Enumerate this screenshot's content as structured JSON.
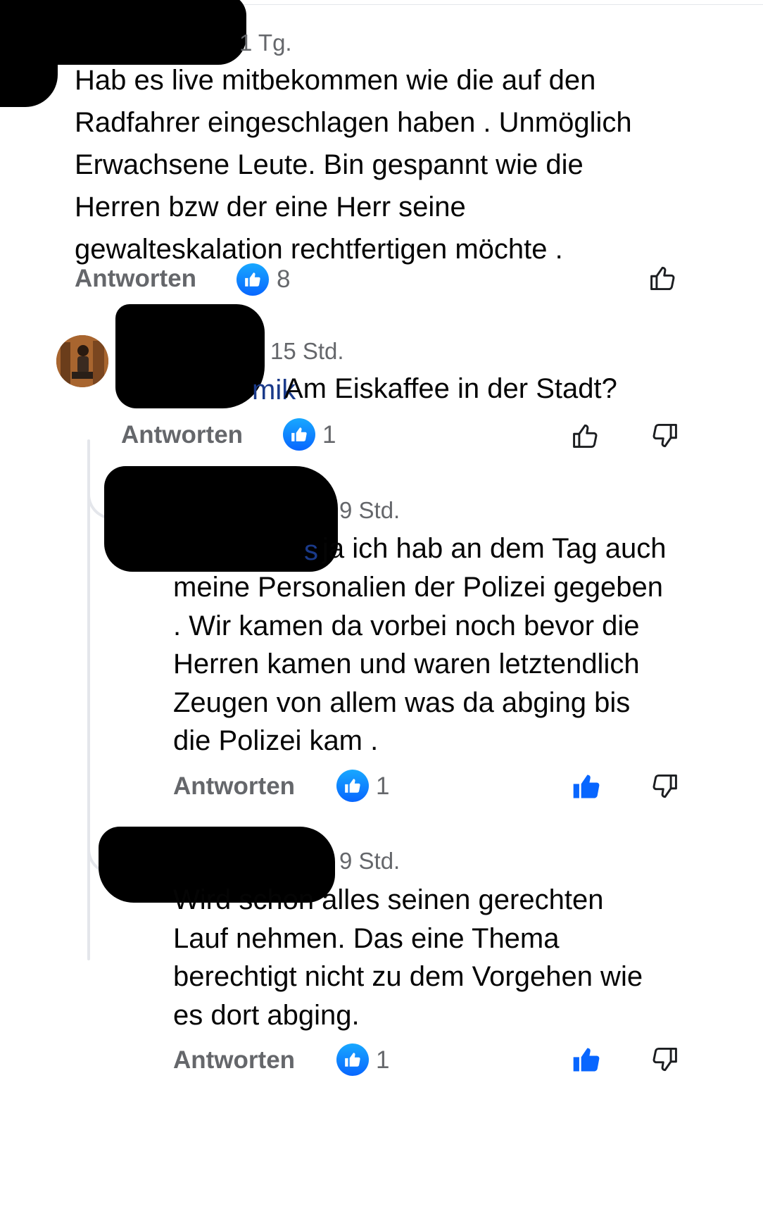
{
  "reply_label": "Antworten",
  "colors": {
    "like_blue": "#0866ff",
    "meta_gray": "#65676b",
    "text": "#050505",
    "thread_line": "#e4e6eb"
  },
  "comments": [
    {
      "time": "1 Tg.",
      "lines": [
        "Hab es live mitbekommen wie die auf den",
        "Radfahrer eingeschlagen haben . Unmöglich",
        "Erwachsene Leute.  Bin gespannt wie die",
        "Herren bzw der eine Herr seine",
        "gewalteskalation rechtfertigen möchte ."
      ],
      "reactions": "8",
      "liked": false
    },
    {
      "time": "15 Std.",
      "mention_fragment": "mik",
      "lines": [
        "Am Eiskaffee in der Stadt?"
      ],
      "reactions": "1",
      "liked": false
    },
    {
      "time": "9 Std.",
      "mention_fragment": "s",
      "lines": [
        "ja ich hab an dem Tag auch",
        "meine Personalien der Polizei gegeben",
        ". Wir kamen da vorbei noch bevor die",
        "Herren kamen und waren letztendlich",
        "Zeugen von allem  was da abging bis",
        "die Polizei kam ."
      ],
      "reactions": "1",
      "liked": true
    },
    {
      "time": "9 Std.",
      "lines": [
        "Wird schon alles seinen gerechten",
        "Lauf nehmen.  Das eine Thema",
        "berechtigt nicht zu dem  Vorgehen wie",
        "es dort abging."
      ],
      "reactions": "1",
      "liked": true
    }
  ],
  "icons": {
    "reaction": "like-badge-icon",
    "like": "thumbs-up-icon",
    "dislike": "thumbs-down-icon"
  }
}
